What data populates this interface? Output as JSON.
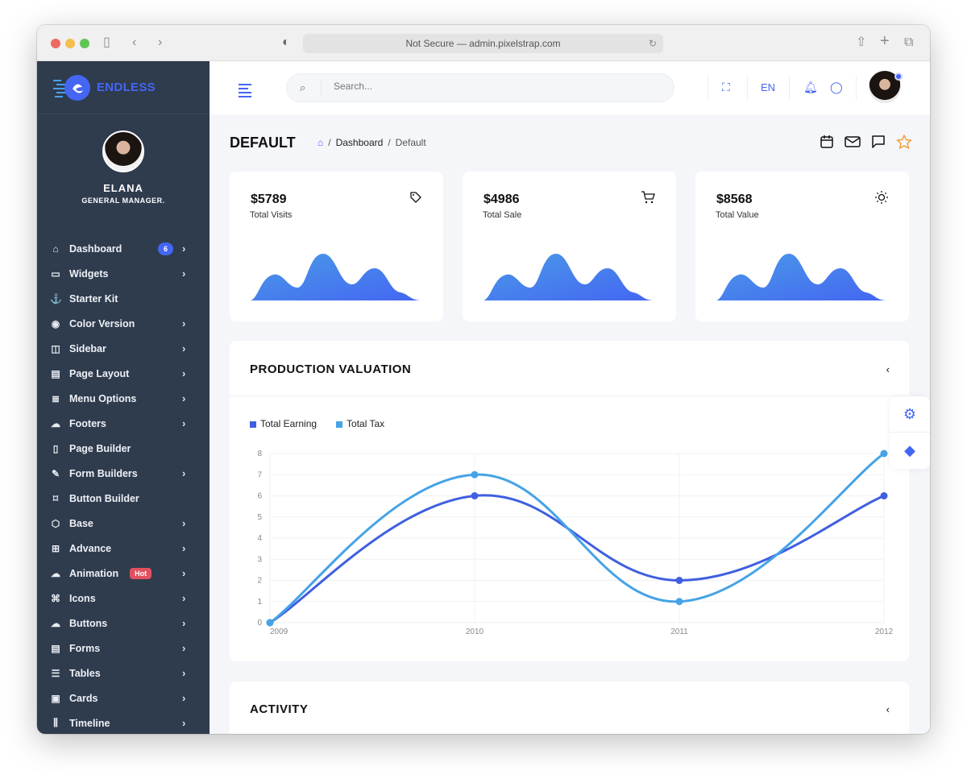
{
  "browser": {
    "url_text": "Not Secure — admin.pixelstrap.com",
    "reload_icon": "↻"
  },
  "brand": {
    "name": "ENDLESS",
    "accent": "#4466f2"
  },
  "profile": {
    "name": "ELANA",
    "role": "GENERAL MANAGER."
  },
  "sidebar": {
    "items": [
      {
        "label": "Dashboard",
        "icon": "⌂",
        "badge": "6",
        "chevron": true
      },
      {
        "label": "Widgets",
        "icon": "▭",
        "chevron": true
      },
      {
        "label": "Starter Kit",
        "icon": "⚓",
        "chevron": false
      },
      {
        "label": "Color Version",
        "icon": "◉",
        "chevron": true
      },
      {
        "label": "Sidebar",
        "icon": "◫",
        "chevron": true
      },
      {
        "label": "Page Layout",
        "icon": "▤",
        "chevron": true
      },
      {
        "label": "Menu Options",
        "icon": "≣",
        "chevron": true
      },
      {
        "label": "Footers",
        "icon": "☁",
        "chevron": true
      },
      {
        "label": "Page Builder",
        "icon": "▯",
        "chevron": false
      },
      {
        "label": "Form Builders",
        "icon": "✎",
        "chevron": true
      },
      {
        "label": "Button Builder",
        "icon": "⌑",
        "chevron": false
      },
      {
        "label": "Base",
        "icon": "⬡",
        "chevron": true
      },
      {
        "label": "Advance",
        "icon": "⊞",
        "chevron": true
      },
      {
        "label": "Animation",
        "icon": "☁",
        "badge_hot": "Hot",
        "chevron": true
      },
      {
        "label": "Icons",
        "icon": "⌘",
        "chevron": true
      },
      {
        "label": "Buttons",
        "icon": "☁",
        "chevron": true
      },
      {
        "label": "Forms",
        "icon": "▤",
        "chevron": true
      },
      {
        "label": "Tables",
        "icon": "☰",
        "chevron": true
      },
      {
        "label": "Cards",
        "icon": "▣",
        "chevron": true
      },
      {
        "label": "Timeline",
        "icon": "⫼",
        "chevron": true
      }
    ],
    "chevron_glyph": "›"
  },
  "header": {
    "search_placeholder": "Search...",
    "language": "EN"
  },
  "page": {
    "title": "DEFAULT",
    "breadcrumb": [
      "Dashboard",
      "Default"
    ],
    "breadcrumb_sep": "/"
  },
  "stats": [
    {
      "currency": "$",
      "value": "5789",
      "label": "Total Visits",
      "icon": "tag"
    },
    {
      "currency": "$",
      "value": "4986",
      "label": "Total Sale",
      "icon": "cart"
    },
    {
      "currency": "$",
      "value": "8568",
      "label": "Total Value",
      "icon": "sun"
    }
  ],
  "production": {
    "title": "PRODUCTION VALUATION",
    "toggle": "‹"
  },
  "activity": {
    "title": "ACTIVITY",
    "toggle": "‹"
  },
  "chart_data": {
    "type": "line",
    "title": "PRODUCTION VALUATION",
    "x": [
      "2009",
      "2010",
      "2011",
      "2012"
    ],
    "series": [
      {
        "name": "Total Earning",
        "color": "#3f5fe0",
        "values": [
          0,
          6,
          2,
          6
        ]
      },
      {
        "name": "Total Tax",
        "color": "#46a3e6",
        "values": [
          0,
          7,
          1,
          8
        ]
      }
    ],
    "yticks": [
      "0",
      "1",
      "2",
      "3",
      "4",
      "5",
      "6",
      "7",
      "8"
    ],
    "ylim": [
      0,
      8
    ],
    "grid": true,
    "legend": "top-left",
    "smooth": true
  }
}
